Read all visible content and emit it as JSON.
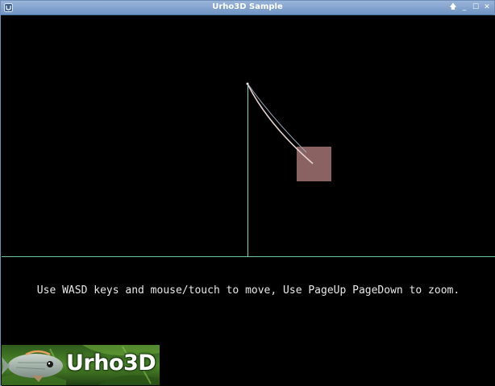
{
  "window": {
    "title": "Urho3D Sample",
    "controls": {
      "keep_above_glyph": "🡅",
      "minimize_glyph": "_",
      "maximize_glyph": "☐",
      "close_glyph": "✕"
    }
  },
  "viewport": {
    "instruction": "Use WASD keys and mouse/touch to move, Use PageUp PageDown to zoom."
  },
  "logo": {
    "text": "Urho3D"
  },
  "colors": {
    "titlebar": "#7fa0cc",
    "background": "#000000",
    "ground_line": "#6ec49a",
    "vertical_line": "#7fd6c0",
    "box": "#8a6262",
    "rope": "#e0c8c8"
  }
}
